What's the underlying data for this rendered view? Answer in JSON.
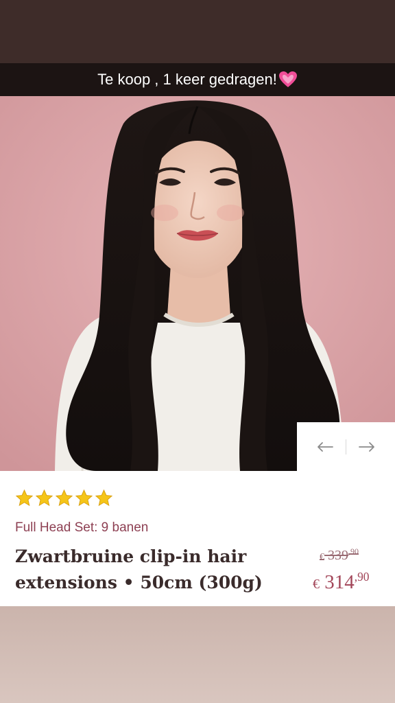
{
  "story": {
    "caption": "Te koop , 1 keer gedragen!",
    "caption_emoji": "pink-heart-icon"
  },
  "gallery": {
    "prev_icon": "arrow-left-icon",
    "next_icon": "arrow-right-icon"
  },
  "product": {
    "rating": 5,
    "rating_max": 5,
    "variant": "Full Head Set: 9 banen",
    "title_line1": "Zwartbruine clip-in hair",
    "title_line2": "extensions • 50cm (300g)",
    "old_price_currency": "€",
    "old_price_main": "339",
    "old_price_cents": ",90",
    "price_currency": "€",
    "price_main": "314",
    "price_cents": ",90"
  },
  "colors": {
    "accent": "#a3475a",
    "caption_bar": "#1c1413",
    "backdrop": "#dba5a8"
  }
}
